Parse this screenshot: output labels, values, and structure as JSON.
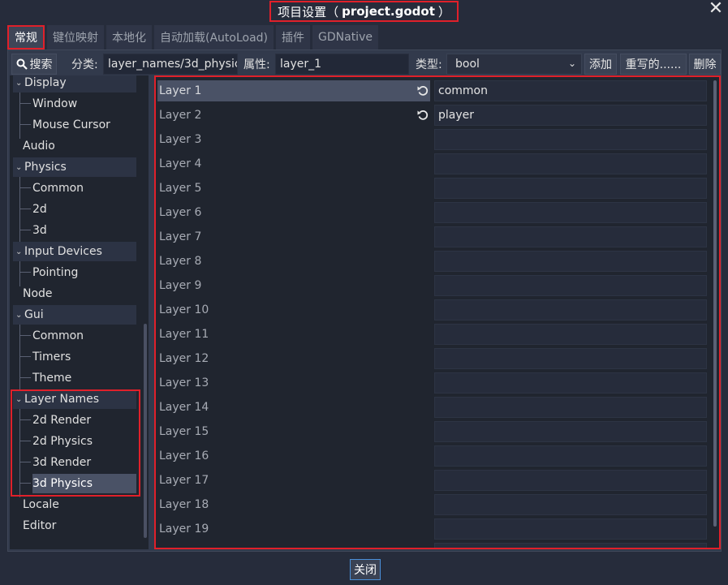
{
  "window": {
    "title_prefix": "项目设置（",
    "title_project": "project.godot",
    "title_suffix": "）",
    "close_glyph": "✕"
  },
  "tabs": [
    {
      "label": "常规",
      "active": true
    },
    {
      "label": "键位映射"
    },
    {
      "label": "本地化"
    },
    {
      "label": "自动加载(AutoLoad)"
    },
    {
      "label": "插件"
    },
    {
      "label": "GDNative"
    }
  ],
  "toolbar": {
    "search_label": "搜索",
    "category_label": "分类:",
    "category_value": "layer_names/3d_physic",
    "property_label": "属性:",
    "property_value": "layer_1",
    "type_label": "类型:",
    "type_value": "bool",
    "add_label": "添加",
    "override_label": "重写的......",
    "delete_label": "删除"
  },
  "tree": [
    {
      "label": "Display"
    },
    {
      "label": "Window"
    },
    {
      "label": "Mouse Cursor"
    },
    {
      "label": "Audio"
    },
    {
      "label": "Physics"
    },
    {
      "label": "Common"
    },
    {
      "label": "2d"
    },
    {
      "label": "3d"
    },
    {
      "label": "Input Devices"
    },
    {
      "label": "Pointing"
    },
    {
      "label": "Node"
    },
    {
      "label": "Gui"
    },
    {
      "label": "Common"
    },
    {
      "label": "Timers"
    },
    {
      "label": "Theme"
    },
    {
      "label": "Layer Names"
    },
    {
      "label": "2d Render"
    },
    {
      "label": "2d Physics"
    },
    {
      "label": "3d Render"
    },
    {
      "label": "3d Physics"
    },
    {
      "label": "Locale"
    },
    {
      "label": "Editor"
    }
  ],
  "properties": [
    {
      "name": "Layer 1",
      "value": "common",
      "modified": true
    },
    {
      "name": "Layer 2",
      "value": "player",
      "modified": true
    },
    {
      "name": "Layer 3",
      "value": ""
    },
    {
      "name": "Layer 4",
      "value": ""
    },
    {
      "name": "Layer 5",
      "value": ""
    },
    {
      "name": "Layer 6",
      "value": ""
    },
    {
      "name": "Layer 7",
      "value": ""
    },
    {
      "name": "Layer 8",
      "value": ""
    },
    {
      "name": "Layer 9",
      "value": ""
    },
    {
      "name": "Layer 10",
      "value": ""
    },
    {
      "name": "Layer 11",
      "value": ""
    },
    {
      "name": "Layer 12",
      "value": ""
    },
    {
      "name": "Layer 13",
      "value": ""
    },
    {
      "name": "Layer 14",
      "value": ""
    },
    {
      "name": "Layer 15",
      "value": ""
    },
    {
      "name": "Layer 16",
      "value": ""
    },
    {
      "name": "Layer 17",
      "value": ""
    },
    {
      "name": "Layer 18",
      "value": ""
    },
    {
      "name": "Layer 19",
      "value": ""
    }
  ],
  "footer": {
    "close_label": "关闭"
  },
  "colors": {
    "accent": "#e0202a",
    "focus": "#4a8fd8"
  }
}
